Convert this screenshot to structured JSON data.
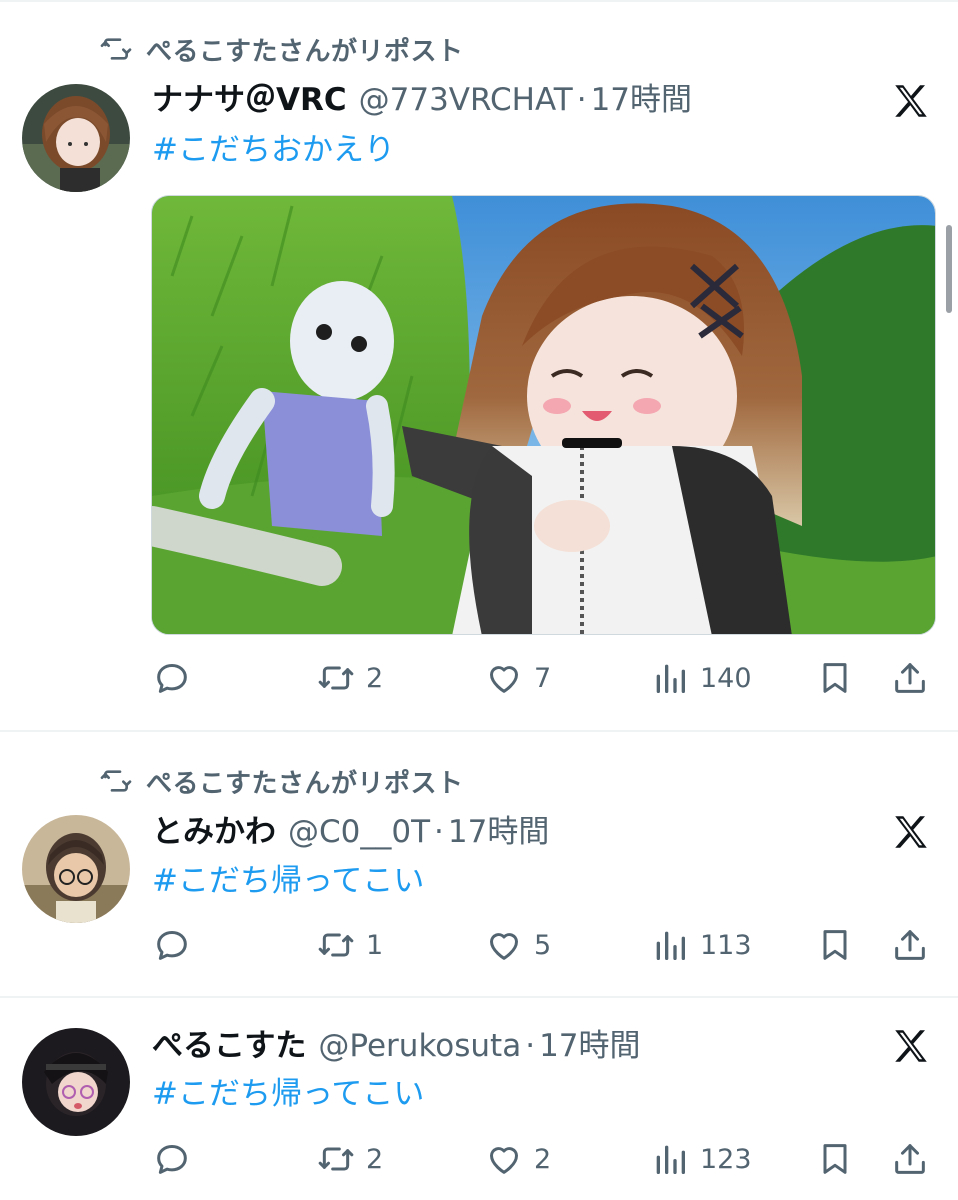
{
  "colors": {
    "link": "#1d9bf0",
    "secondary": "#536471",
    "text": "#0f1419",
    "divider": "#eff3f4"
  },
  "tweets": [
    {
      "repost_label": "ぺるこすたさんがリポスト",
      "display_name": "ナナサ＠VRC",
      "handle": "@773VRCHAT",
      "separator": "·",
      "time": "17時間",
      "hashtag": "#こだちおかえり",
      "has_media": true,
      "replies": "",
      "reposts": "2",
      "likes": "7",
      "views": "140",
      "icons": [
        "reply-icon",
        "repost-icon",
        "like-icon",
        "views-icon",
        "bookmark-icon",
        "share-icon"
      ]
    },
    {
      "repost_label": "ぺるこすたさんがリポスト",
      "display_name": "とみかわ",
      "handle": "@C0__0T",
      "separator": "·",
      "time": "17時間",
      "hashtag": "#こだち帰ってこい",
      "has_media": false,
      "replies": "",
      "reposts": "1",
      "likes": "5",
      "views": "113",
      "icons": [
        "reply-icon",
        "repost-icon",
        "like-icon",
        "views-icon",
        "bookmark-icon",
        "share-icon"
      ]
    },
    {
      "repost_label": "",
      "display_name": "ぺるこすた",
      "handle": "@Perukosuta",
      "separator": "·",
      "time": "17時間",
      "hashtag": "#こだち帰ってこい",
      "has_media": false,
      "replies": "",
      "reposts": "2",
      "likes": "2",
      "views": "123",
      "icons": [
        "reply-icon",
        "repost-icon",
        "like-icon",
        "views-icon",
        "bookmark-icon",
        "share-icon"
      ]
    }
  ]
}
